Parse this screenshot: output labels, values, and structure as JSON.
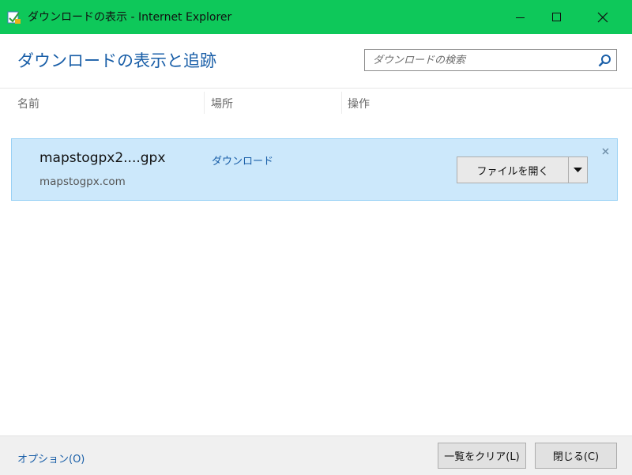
{
  "window": {
    "title": "ダウンロードの表示 - Internet Explorer",
    "accent_color": "#0ec85a",
    "icons": [
      "ie-download-icon",
      "minimize-icon",
      "maximize-icon",
      "close-icon"
    ]
  },
  "header": {
    "title": "ダウンロードの表示と追跡",
    "search": {
      "placeholder": "ダウンロードの検索",
      "value": ""
    }
  },
  "columns": [
    "名前",
    "場所",
    "操作"
  ],
  "downloads": [
    {
      "name": "mapstogpx2....gpx",
      "source": "mapstogpx.com",
      "location": "ダウンロード",
      "action_label": "ファイルを開く"
    }
  ],
  "footer": {
    "options_label": "オプション(O)",
    "clear_label": "一覧をクリア(L)",
    "close_label": "閉じる(C)"
  }
}
